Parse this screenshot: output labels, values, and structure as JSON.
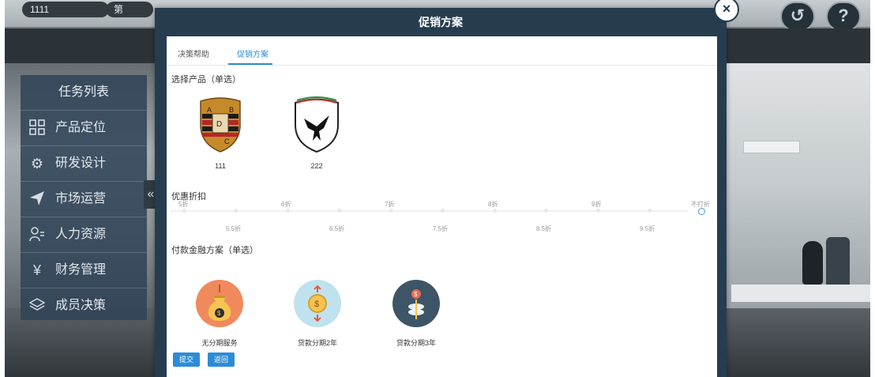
{
  "background": {
    "top_items": [
      "1111",
      "第"
    ],
    "history_icon": "history-icon",
    "help_icon": "help-icon"
  },
  "sidebar": {
    "title": "任务列表",
    "items": [
      {
        "label": "产品定位",
        "icon": "grid-icon"
      },
      {
        "label": "研发设计",
        "icon": "gear-icon"
      },
      {
        "label": "市场运营",
        "icon": "send-icon"
      },
      {
        "label": "人力资源",
        "icon": "user-list-icon"
      },
      {
        "label": "财务管理",
        "icon": "yen-icon"
      },
      {
        "label": "成员决策",
        "icon": "layers-icon"
      }
    ],
    "collapse_glyph": "«"
  },
  "modal": {
    "title": "促销方案",
    "close_glyph": "×",
    "tabs": [
      {
        "label": "决策帮助",
        "active": false
      },
      {
        "label": "促销方案",
        "active": true
      }
    ],
    "product_section": "选择产品（单选）",
    "products": [
      {
        "label": "111"
      },
      {
        "label": "222"
      }
    ],
    "discount_section": "优惠折扣",
    "discount_top": [
      "5折",
      "6折",
      "7折",
      "8折",
      "9折",
      "不打折"
    ],
    "discount_bottom": [
      "5.5折",
      "6.5折",
      "7.5折",
      "8.5折",
      "9.5折"
    ],
    "discount_selected": "不打折",
    "finance_section": "付款金融方案（单选）",
    "finance": [
      {
        "label": "无分期服务"
      },
      {
        "label": "贷款分期2年"
      },
      {
        "label": "贷款分期3年"
      }
    ],
    "buttons": {
      "submit": "提交",
      "back": "返回"
    }
  },
  "colors": {
    "accent": "#2b8cd8",
    "modal_header": "#263d4f",
    "sidebar_bg": "#2f4256"
  }
}
